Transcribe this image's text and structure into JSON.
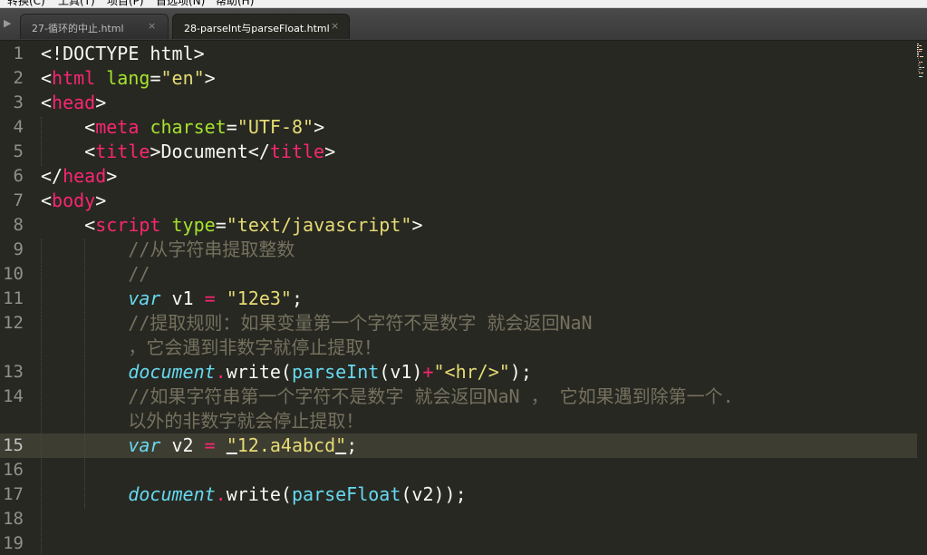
{
  "menu": {
    "items": [
      "转换(C)",
      "工具(T)",
      "项目(P)",
      "首选项(N)",
      "帮助(H)"
    ]
  },
  "tabs": [
    {
      "label": "27-循环的中止.html",
      "active": false,
      "close": "×"
    },
    {
      "label": "28-parseInt与parseFloat.html",
      "active": true,
      "close": "×"
    }
  ],
  "tab_scroll_icon": "▶",
  "editor": {
    "current_line": 15,
    "lines": [
      {
        "num": "1",
        "tokens": [
          [
            "pl",
            "<!DOCTYPE html>"
          ]
        ]
      },
      {
        "num": "2",
        "tokens": [
          [
            "pl",
            "<"
          ],
          [
            "tag",
            "html"
          ],
          [
            "pl",
            " "
          ],
          [
            "attr",
            "lang"
          ],
          [
            "pl",
            "="
          ],
          [
            "str",
            "\"en\""
          ],
          [
            "pl",
            ">"
          ]
        ]
      },
      {
        "num": "3",
        "tokens": [
          [
            "pl",
            "<"
          ],
          [
            "tag",
            "head"
          ],
          [
            "pl",
            ">"
          ]
        ]
      },
      {
        "num": "4",
        "tokens": [
          [
            "pl",
            "    <"
          ],
          [
            "tag",
            "meta"
          ],
          [
            "pl",
            " "
          ],
          [
            "attr",
            "charset"
          ],
          [
            "pl",
            "="
          ],
          [
            "str",
            "\"UTF-8\""
          ],
          [
            "pl",
            ">"
          ]
        ]
      },
      {
        "num": "5",
        "tokens": [
          [
            "pl",
            "    <"
          ],
          [
            "tag",
            "title"
          ],
          [
            "pl",
            ">Document</"
          ],
          [
            "tag",
            "title"
          ],
          [
            "pl",
            ">"
          ]
        ]
      },
      {
        "num": "6",
        "tokens": [
          [
            "pl",
            "</"
          ],
          [
            "tag",
            "head"
          ],
          [
            "pl",
            ">"
          ]
        ]
      },
      {
        "num": "7",
        "tokens": [
          [
            "pl",
            "<"
          ],
          [
            "tag",
            "body"
          ],
          [
            "pl",
            ">"
          ]
        ]
      },
      {
        "num": "8",
        "tokens": [
          [
            "pl",
            "    <"
          ],
          [
            "tag",
            "script"
          ],
          [
            "pl",
            " "
          ],
          [
            "attr",
            "type"
          ],
          [
            "pl",
            "="
          ],
          [
            "str",
            "\"text/javascript\""
          ],
          [
            "pl",
            ">"
          ]
        ]
      },
      {
        "num": "9",
        "tokens": [
          [
            "cmt",
            "        //从字符串提取整数"
          ]
        ]
      },
      {
        "num": "10",
        "tokens": [
          [
            "cmt",
            "        //"
          ]
        ]
      },
      {
        "num": "11",
        "tokens": [
          [
            "pl",
            "        "
          ],
          [
            "kw",
            "var"
          ],
          [
            "pl",
            " v1 "
          ],
          [
            "op",
            "="
          ],
          [
            "pl",
            " "
          ],
          [
            "str",
            "\"12e3\""
          ],
          [
            "pl",
            ";"
          ]
        ]
      },
      {
        "num": "12",
        "tokens": [
          [
            "cmt",
            "        //提取规则：如果变量第一个字符不是数字 就会返回NaN"
          ]
        ]
      },
      {
        "num": "",
        "tokens": [
          [
            "cmt",
            "        ，它会遇到非数字就停止提取！"
          ]
        ]
      },
      {
        "num": "13",
        "tokens": [
          [
            "pl",
            "        "
          ],
          [
            "kw",
            "document"
          ],
          [
            "op",
            "."
          ],
          [
            "pl",
            "write("
          ],
          [
            "fn",
            "parseInt"
          ],
          [
            "pl",
            "(v1)"
          ],
          [
            "op",
            "+"
          ],
          [
            "str",
            "\"<hr/>\""
          ],
          [
            "pl",
            ");"
          ]
        ]
      },
      {
        "num": "14",
        "tokens": [
          [
            "cmt",
            "        //如果字符串第一个字符不是数字 就会返回NaN ， 它如果遇到除第一个."
          ]
        ]
      },
      {
        "num": "",
        "tokens": [
          [
            "cmt",
            "        以外的非数字就会停止提取！"
          ]
        ]
      },
      {
        "num": "15",
        "tokens": [
          [
            "pl",
            "        "
          ],
          [
            "kw",
            "var"
          ],
          [
            "pl",
            " v2 "
          ],
          [
            "op",
            "="
          ],
          [
            "pl",
            " "
          ],
          [
            "strm",
            "\""
          ],
          [
            "str",
            "12.a4abcd"
          ],
          [
            "strm",
            "\""
          ],
          [
            "pl",
            ";"
          ]
        ]
      },
      {
        "num": "16",
        "tokens": []
      },
      {
        "num": "17",
        "tokens": [
          [
            "pl",
            "        "
          ],
          [
            "kw",
            "document"
          ],
          [
            "op",
            "."
          ],
          [
            "pl",
            "write("
          ],
          [
            "fn",
            "parseFloat"
          ],
          [
            "pl",
            "(v2));"
          ]
        ]
      },
      {
        "num": "18",
        "tokens": []
      },
      {
        "num": "19",
        "tokens": []
      }
    ]
  },
  "colors": {
    "background": "#272822",
    "tag": "#f92672",
    "attribute": "#a6e22e",
    "string": "#e6db74",
    "comment": "#75715e",
    "keyword": "#66d9ef",
    "plain": "#f8f8f2"
  }
}
